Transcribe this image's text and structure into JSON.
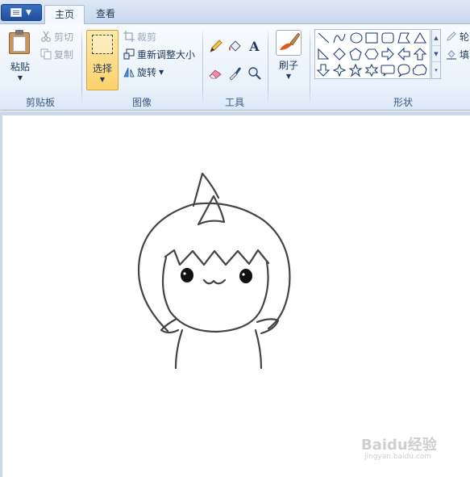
{
  "tabs": [
    {
      "label": "主页",
      "active": true
    },
    {
      "label": "查看",
      "active": false
    }
  ],
  "clipboard": {
    "paste_label": "粘贴",
    "cut_label": "剪切",
    "copy_label": "复制",
    "group_label": "剪贴板"
  },
  "image": {
    "select_label": "选择",
    "crop_label": "裁剪",
    "resize_label": "重新调整大小",
    "rotate_label": "旋转",
    "group_label": "图像"
  },
  "tools": {
    "text_tool_glyph": "A",
    "group_label": "工具"
  },
  "brush": {
    "label": "刷子"
  },
  "shapes": {
    "outline_label": "轮",
    "fill_label": "填",
    "group_label": "形状"
  },
  "watermark": {
    "brand": "Baidu经验",
    "url": "jingyan.baidu.com"
  },
  "colors": {
    "accent": "#1e395b",
    "select_active": "#fbd26b",
    "canvas_bg": "#ffffff",
    "workspace_bg": "#c9d8ec"
  }
}
